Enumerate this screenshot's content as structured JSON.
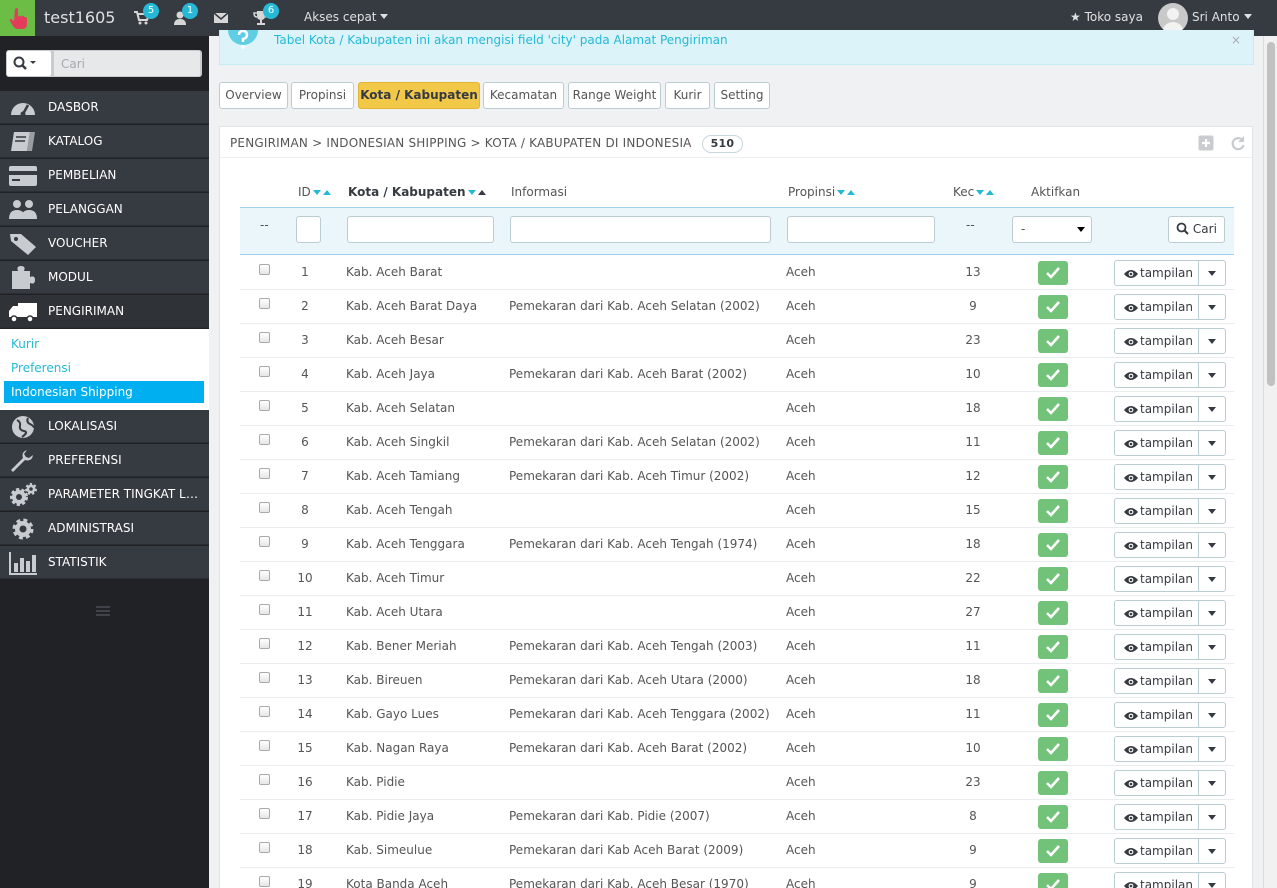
{
  "header": {
    "shop_name": "test1605",
    "cart_count": "5",
    "customers_count": "1",
    "trophy_count": "6",
    "quick_access": "Akses cepat",
    "my_shop": "Toko saya",
    "user_name": "Sri Anto"
  },
  "sidebar": {
    "search_placeholder": "Cari",
    "items": [
      {
        "label": "DASBOR",
        "icon": "dashboard-icon"
      },
      {
        "label": "KATALOG",
        "icon": "book-icon"
      },
      {
        "label": "PEMBELIAN",
        "icon": "credit-card-icon"
      },
      {
        "label": "PELANGGAN",
        "icon": "users-icon"
      },
      {
        "label": "VOUCHER",
        "icon": "tag-icon"
      },
      {
        "label": "MODUL",
        "icon": "puzzle-icon"
      },
      {
        "label": "PENGIRIMAN",
        "icon": "truck-icon"
      },
      {
        "label": "LOKALISASI",
        "icon": "globe-icon"
      },
      {
        "label": "PREFERENSI",
        "icon": "wrench-icon"
      },
      {
        "label": "PARAMETER TINGKAT LANJUT",
        "icon": "cogs-icon"
      },
      {
        "label": "ADMINISTRASI",
        "icon": "cog-icon"
      },
      {
        "label": "STATISTIK",
        "icon": "bar-chart-icon"
      }
    ],
    "submenu": [
      "Kurir",
      "Preferensi",
      "Indonesian Shipping"
    ]
  },
  "alert": {
    "text": "Tabel Kota / Kabupaten ini akan mengisi field 'city' pada Alamat Pengiriman",
    "close": "×"
  },
  "tabs": [
    "Overview",
    "Propinsi",
    "Kota / Kabupaten",
    "Kecamatan",
    "Range Weight",
    "Kurir",
    "Setting"
  ],
  "panel": {
    "heading": "PENGIRIMAN > INDONESIAN SHIPPING > KOTA / KABUPATEN DI INDONESIA",
    "count": "510"
  },
  "table": {
    "headers": {
      "id": "ID",
      "name": "Kota / Kabupaten",
      "info": "Informasi",
      "province": "Propinsi",
      "kec": "Kec",
      "active": "Aktifkan"
    },
    "filter": {
      "dash": "--",
      "select_value": "-",
      "search_label": "Cari"
    },
    "view_label": "tampilan",
    "rows": [
      {
        "id": "1",
        "name": "Kab. Aceh Barat",
        "info": "",
        "province": "Aceh",
        "kec": "13"
      },
      {
        "id": "2",
        "name": "Kab. Aceh Barat Daya",
        "info": "Pemekaran dari Kab. Aceh Selatan (2002)",
        "province": "Aceh",
        "kec": "9"
      },
      {
        "id": "3",
        "name": "Kab. Aceh Besar",
        "info": "",
        "province": "Aceh",
        "kec": "23"
      },
      {
        "id": "4",
        "name": "Kab. Aceh Jaya",
        "info": "Pemekaran dari Kab. Aceh Barat (2002)",
        "province": "Aceh",
        "kec": "10"
      },
      {
        "id": "5",
        "name": "Kab. Aceh Selatan",
        "info": "",
        "province": "Aceh",
        "kec": "18"
      },
      {
        "id": "6",
        "name": "Kab. Aceh Singkil",
        "info": "Pemekaran dari Kab. Aceh Selatan (2002)",
        "province": "Aceh",
        "kec": "11"
      },
      {
        "id": "7",
        "name": "Kab. Aceh Tamiang",
        "info": "Pemekaran dari Kab. Aceh Timur (2002)",
        "province": "Aceh",
        "kec": "12"
      },
      {
        "id": "8",
        "name": "Kab. Aceh Tengah",
        "info": "",
        "province": "Aceh",
        "kec": "15"
      },
      {
        "id": "9",
        "name": "Kab. Aceh Tenggara",
        "info": "Pemekaran dari Kab. Aceh Tengah (1974)",
        "province": "Aceh",
        "kec": "18"
      },
      {
        "id": "10",
        "name": "Kab. Aceh Timur",
        "info": "",
        "province": "Aceh",
        "kec": "22"
      },
      {
        "id": "11",
        "name": "Kab. Aceh Utara",
        "info": "",
        "province": "Aceh",
        "kec": "27"
      },
      {
        "id": "12",
        "name": "Kab. Bener Meriah",
        "info": "Pemekaran dari Kab. Aceh Tengah (2003)",
        "province": "Aceh",
        "kec": "11"
      },
      {
        "id": "13",
        "name": "Kab. Bireuen",
        "info": "Pemekaran dari Kab. Aceh Utara (2000)",
        "province": "Aceh",
        "kec": "18"
      },
      {
        "id": "14",
        "name": "Kab. Gayo Lues",
        "info": "Pemekaran dari Kab. Aceh Tenggara (2002)",
        "province": "Aceh",
        "kec": "11"
      },
      {
        "id": "15",
        "name": "Kab. Nagan Raya",
        "info": "Pemekaran dari Kab. Aceh Barat (2002)",
        "province": "Aceh",
        "kec": "10"
      },
      {
        "id": "16",
        "name": "Kab. Pidie",
        "info": "",
        "province": "Aceh",
        "kec": "23"
      },
      {
        "id": "17",
        "name": "Kab. Pidie Jaya",
        "info": "Pemekaran dari Kab. Pidie (2007)",
        "province": "Aceh",
        "kec": "8"
      },
      {
        "id": "18",
        "name": "Kab. Simeulue",
        "info": "Pemekaran dari Kab Aceh Barat (2009)",
        "province": "Aceh",
        "kec": "9"
      },
      {
        "id": "19",
        "name": "Kota Banda Aceh",
        "info": "Pemekaran dari Kab. Aceh Besar (1970)",
        "province": "Aceh",
        "kec": "9"
      }
    ]
  }
}
